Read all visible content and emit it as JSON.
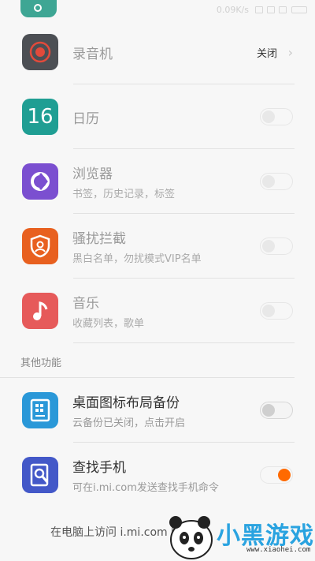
{
  "status": {
    "net_speed": "0.09K/s",
    "battery": "81%"
  },
  "items": [
    {
      "id": "recorder",
      "title": "录音机",
      "subtitle": "",
      "value": "关闭",
      "control": "link",
      "icon": "record-icon",
      "color": "#4c4f54"
    },
    {
      "id": "calendar",
      "title": "日历",
      "subtitle": "",
      "control": "toggle",
      "state": "off",
      "icon": "calendar-icon",
      "icon_text": "16",
      "color": "#1f9e93"
    },
    {
      "id": "browser",
      "title": "浏览器",
      "subtitle": "书签，历史记录，标签",
      "control": "toggle",
      "state": "off",
      "icon": "browser-icon",
      "color": "#7b4fd0"
    },
    {
      "id": "harass",
      "title": "骚扰拦截",
      "subtitle": "黑白名单，勿扰模式VIP名单",
      "control": "toggle",
      "state": "off",
      "icon": "shield-user-icon",
      "color": "#e8601f"
    },
    {
      "id": "music",
      "title": "音乐",
      "subtitle": "收藏列表，歌单",
      "control": "toggle",
      "state": "off",
      "icon": "music-icon",
      "color": "#e65a5a"
    }
  ],
  "section": {
    "title": "其他功能"
  },
  "other_items": [
    {
      "id": "desktop-backup",
      "title": "桌面图标布局备份",
      "subtitle": "云备份已关闭，点击开启",
      "control": "toggle",
      "state": "off",
      "icon": "desktop-layout-icon",
      "color": "#2a98d8"
    },
    {
      "id": "find-phone",
      "title": "查找手机",
      "subtitle": "可在i.mi.com发送查找手机命令",
      "control": "toggle",
      "state": "on",
      "icon": "find-phone-icon",
      "color": "#4358c8"
    }
  ],
  "footer": {
    "text": "在电脑上访问 i.mi.com 随"
  },
  "watermark": {
    "text": "小黑游戏",
    "url": "www.xiaohei.com"
  },
  "accent": "#ff6a00"
}
